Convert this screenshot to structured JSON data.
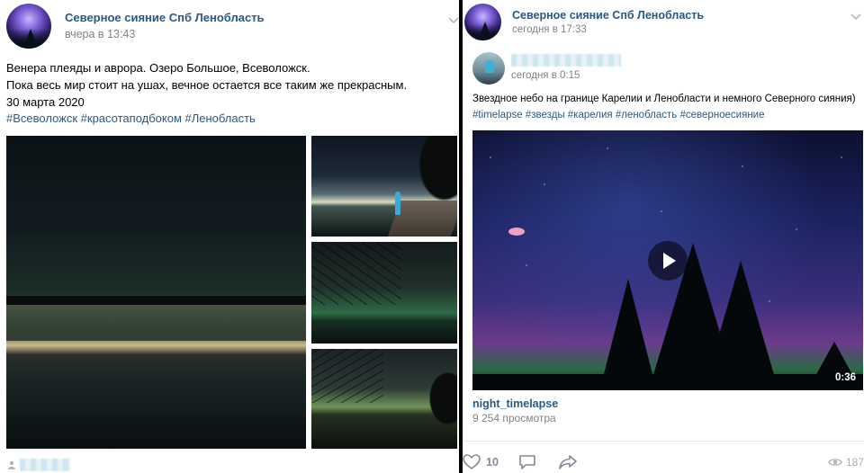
{
  "left_post": {
    "group_name": "Северное сияние Спб Ленобласть",
    "time": "вчера в 13:43",
    "text_lines": [
      "Венера плеяды и аврора. Озеро Большое, Всеволожск.",
      "Пока весь мир стоит на ушах, вечное остается все таким же прекрасным.",
      "30 марта 2020"
    ],
    "hashtags": "#Всеволожск #красотаподбоком #Ленобласть"
  },
  "right_post": {
    "group_name": "Северное сияние Спб Ленобласть",
    "time": "сегодня в 17:33",
    "repost_time": "сегодня в 0:15",
    "text": "Звездное небо на границе Карелии и Ленобласти и немного Северного сияния)",
    "hashtags": "#timelapse #звезды #карелия #ленобласть #северноесияние",
    "video": {
      "duration": "0:36",
      "title": "night_timelapse",
      "views": "9 254 просмотра"
    },
    "actions": {
      "likes": "10",
      "views": "187"
    }
  },
  "colors": {
    "link": "#2a5885",
    "meta": "#828282"
  }
}
